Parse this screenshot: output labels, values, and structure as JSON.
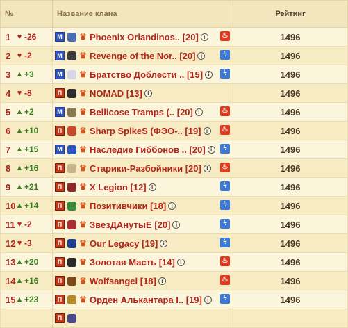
{
  "header": {
    "num": "№",
    "clan_name": "Название клана",
    "rating": "Рейтинг"
  },
  "rows": [
    {
      "rank": "1",
      "dir": "down",
      "delta": "-26",
      "name": "Phoenix Orlandinos..",
      "level": "[20]",
      "badge": "M",
      "element": "fire",
      "rating": "1496"
    },
    {
      "rank": "2",
      "dir": "down",
      "delta": "-2",
      "name": "Revenge of the Nor..",
      "level": "[20]",
      "badge": "M",
      "element": "lightning",
      "rating": "1496"
    },
    {
      "rank": "3",
      "dir": "up",
      "delta": "+3",
      "name": "Братство Доблести ..",
      "level": "[15]",
      "badge": "M",
      "element": "lightning",
      "rating": "1496"
    },
    {
      "rank": "4",
      "dir": "down",
      "delta": "-8",
      "name": "NOMAD",
      "level": "[13]",
      "badge": "П",
      "element": "",
      "rating": "1496"
    },
    {
      "rank": "5",
      "dir": "up",
      "delta": "+2",
      "name": "Bellicose Tramps (..",
      "level": "[20]",
      "badge": "M",
      "element": "fire",
      "rating": "1496"
    },
    {
      "rank": "6",
      "dir": "up",
      "delta": "+10",
      "name": "Sharp SpikeS (ФЭО-..",
      "level": "[19]",
      "badge": "П",
      "element": "fire",
      "rating": "1496"
    },
    {
      "rank": "7",
      "dir": "up",
      "delta": "+15",
      "name": "Наследие Гиббонов ..",
      "level": "[20]",
      "badge": "M",
      "element": "lightning",
      "rating": "1496"
    },
    {
      "rank": "8",
      "dir": "up",
      "delta": "+16",
      "name": "Старики-Разбойники",
      "level": "[20]",
      "badge": "П",
      "element": "fire",
      "rating": "1496"
    },
    {
      "rank": "9",
      "dir": "up",
      "delta": "+21",
      "name": "X Legion",
      "level": "[12]",
      "badge": "П",
      "element": "lightning",
      "rating": "1496"
    },
    {
      "rank": "10",
      "dir": "up",
      "delta": "+14",
      "name": "Позитивчики",
      "level": "[18]",
      "badge": "П",
      "element": "lightning",
      "rating": "1496"
    },
    {
      "rank": "11",
      "dir": "down",
      "delta": "-2",
      "name": "ЗвезДАнутыЕ",
      "level": "[20]",
      "badge": "П",
      "element": "lightning",
      "rating": "1496"
    },
    {
      "rank": "12",
      "dir": "down",
      "delta": "-3",
      "name": "Our Legacy",
      "level": "[19]",
      "badge": "П",
      "element": "lightning",
      "rating": "1496"
    },
    {
      "rank": "13",
      "dir": "up",
      "delta": "+20",
      "name": "Золотая Масть",
      "level": "[14]",
      "badge": "П",
      "element": "fire",
      "rating": "1496"
    },
    {
      "rank": "14",
      "dir": "up",
      "delta": "+16",
      "name": "Wolfsangel",
      "level": "[18]",
      "badge": "П",
      "element": "fire",
      "rating": "1496"
    },
    {
      "rank": "15",
      "dir": "up",
      "delta": "+23",
      "name": "Орден Алькантара I..",
      "level": "[19]",
      "badge": "П",
      "element": "lightning",
      "rating": "1496"
    },
    {
      "rank": "",
      "dir": "",
      "delta": "",
      "name": "",
      "level": "",
      "badge": "П",
      "element": "",
      "rating": ""
    }
  ],
  "colors": {
    "red": "#b2261c",
    "green": "#3a7e23",
    "fire": "#e0391b",
    "lightning": "#3b79d6"
  },
  "icons": {
    "up": "arrow-up-icon",
    "down": "heart-down-icon",
    "crown": "crown-icon",
    "info": "info-icon",
    "fire": "fire-icon",
    "lightning": "lightning-icon"
  }
}
